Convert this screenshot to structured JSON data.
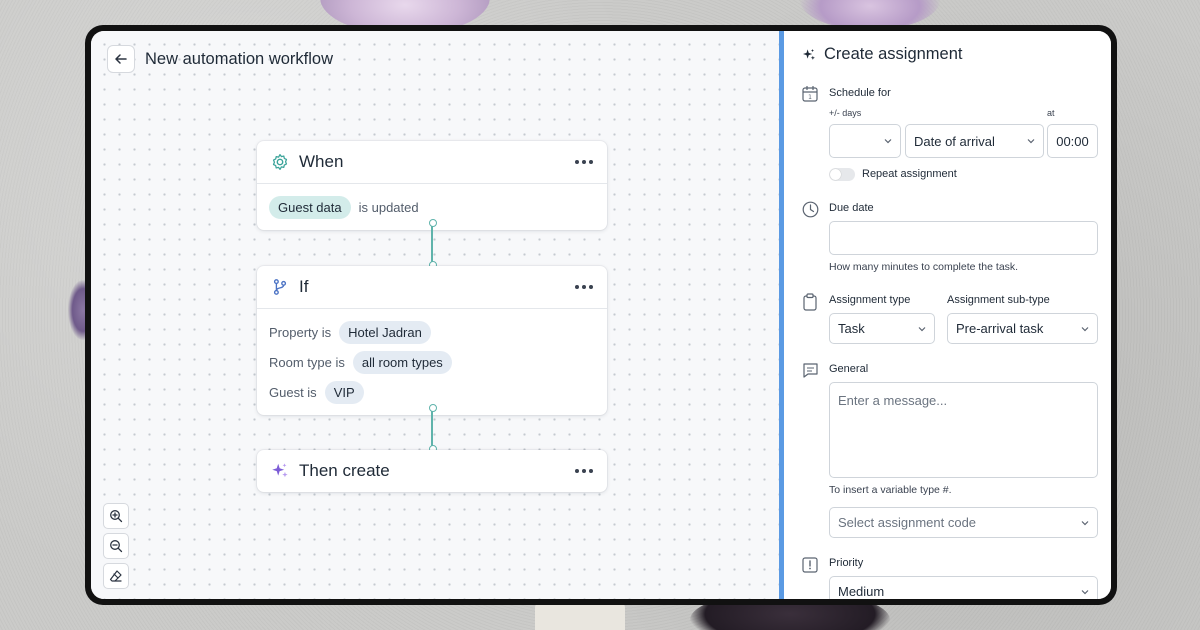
{
  "workflow": {
    "title": "New automation workflow",
    "nodes": {
      "when": {
        "title": "When",
        "chip": "Guest data",
        "text": "is updated"
      },
      "if": {
        "title": "If",
        "rows": [
          {
            "label": "Property is",
            "value": "Hotel Jadran"
          },
          {
            "label": "Room type is",
            "value": "all room types"
          },
          {
            "label": "Guest is",
            "value": "VIP"
          }
        ]
      },
      "then": {
        "title": "Then create"
      }
    },
    "tools": [
      "zoom-in-icon",
      "zoom-out-icon",
      "eraser-icon"
    ]
  },
  "panel": {
    "title": "Create assignment",
    "schedule": {
      "label": "Schedule for",
      "days_label": "+/- days",
      "days_value": "",
      "anchor_value": "Date of arrival",
      "at_label": "at",
      "time_value": "00:00",
      "repeat_label": "Repeat assignment"
    },
    "due_date": {
      "label": "Due date",
      "value": "",
      "hint": "How many minutes to complete the task."
    },
    "assignment_type": {
      "label": "Assignment type",
      "value": "Task",
      "sub_label": "Assignment sub-type",
      "sub_value": "Pre-arrival task"
    },
    "general": {
      "label": "General",
      "placeholder": "Enter a message...",
      "hint": "To insert a variable type #.",
      "code_placeholder": "Select assignment code"
    },
    "priority": {
      "label": "Priority",
      "value": "Medium"
    }
  },
  "colors": {
    "accent_blue": "#5b9ae3",
    "connector_teal": "#5fb3ab",
    "sparkle_purple": "#7c5cd6"
  }
}
